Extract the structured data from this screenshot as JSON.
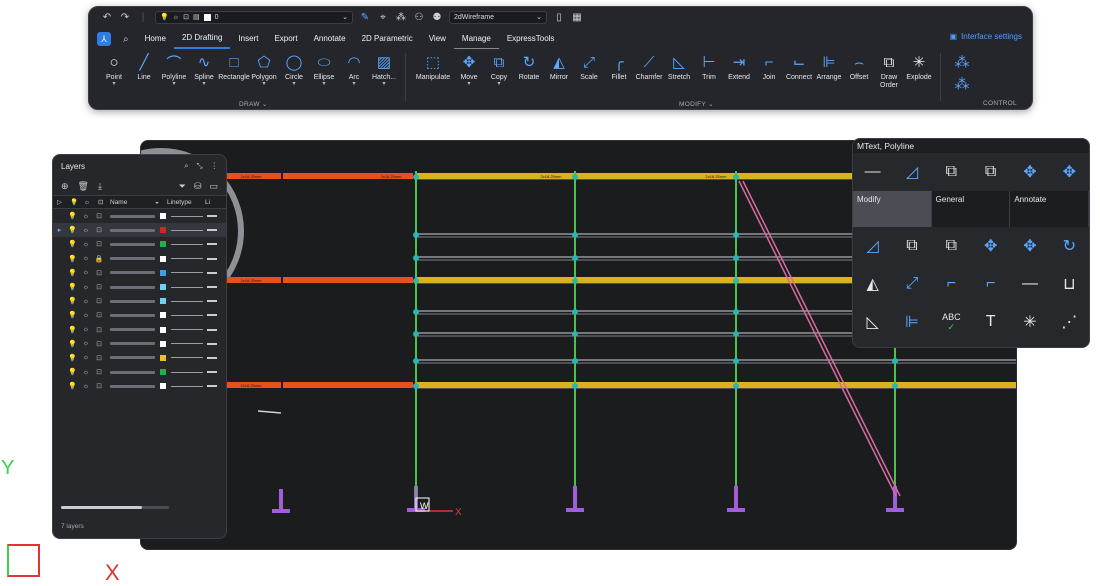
{
  "ribbon": {
    "quick_access": {
      "layer_value": "0",
      "visual_style": "2dWireframe"
    },
    "tabs": [
      "Home",
      "2D Drafting",
      "Insert",
      "Export",
      "Annotate",
      "2D Parametric",
      "View",
      "Manage",
      "ExpressTools"
    ],
    "active_tab": "2D Drafting",
    "interface_settings": "Interface settings",
    "draw_tools": [
      {
        "label": "Point",
        "icon": "point-icon"
      },
      {
        "label": "Line",
        "icon": "line-icon"
      },
      {
        "label": "Polyline",
        "icon": "polyline-icon"
      },
      {
        "label": "Spline",
        "icon": "spline-icon"
      },
      {
        "label": "Rectangle",
        "icon": "rectangle-icon"
      },
      {
        "label": "Polygon",
        "icon": "polygon-icon"
      },
      {
        "label": "Circle",
        "icon": "circle-icon"
      },
      {
        "label": "Ellipse",
        "icon": "ellipse-icon"
      },
      {
        "label": "Arc",
        "icon": "arc-icon"
      },
      {
        "label": "Hatch...",
        "icon": "hatch-icon"
      }
    ],
    "modify_tools": [
      {
        "label": "Manipulate",
        "icon": "manipulate-icon"
      },
      {
        "label": "Move",
        "icon": "move-icon"
      },
      {
        "label": "Copy",
        "icon": "copy-icon"
      },
      {
        "label": "Rotate",
        "icon": "rotate-icon"
      },
      {
        "label": "Mirror",
        "icon": "mirror-icon"
      },
      {
        "label": "Scale",
        "icon": "scale-icon"
      },
      {
        "label": "Fillet",
        "icon": "fillet-icon"
      },
      {
        "label": "Chamfer",
        "icon": "chamfer-icon"
      },
      {
        "label": "Stretch",
        "icon": "stretch-icon"
      },
      {
        "label": "Trim",
        "icon": "trim-icon"
      },
      {
        "label": "Extend",
        "icon": "extend-icon"
      },
      {
        "label": "Join",
        "icon": "join-icon"
      },
      {
        "label": "Connect",
        "icon": "connect-icon"
      },
      {
        "label": "Arrange",
        "icon": "arrange-icon"
      },
      {
        "label": "Offset",
        "icon": "offset-icon"
      },
      {
        "label": "Draw Order",
        "icon": "draw-order-icon"
      },
      {
        "label": "Explode",
        "icon": "explode-icon"
      }
    ],
    "groups": {
      "draw": "DRAW",
      "modify": "MODIFY",
      "control": "CONTROL"
    }
  },
  "layers_panel": {
    "title": "Layers",
    "columns": [
      "Name",
      "Linetype",
      "Li"
    ],
    "rows": [
      {
        "color": "#ffffff",
        "selected": false,
        "locked": false,
        "frozen": false
      },
      {
        "color": "#e02020",
        "selected": true,
        "locked": false,
        "frozen": false
      },
      {
        "color": "#20b24a",
        "selected": false,
        "locked": false,
        "frozen": false
      },
      {
        "color": "#ffffff",
        "selected": false,
        "locked": true,
        "frozen": false
      },
      {
        "color": "#3aa0e8",
        "selected": false,
        "locked": false,
        "frozen": false
      },
      {
        "color": "#6fd0f0",
        "selected": false,
        "locked": false,
        "frozen": false
      },
      {
        "color": "#6fd0f0",
        "selected": false,
        "locked": false,
        "frozen": false
      },
      {
        "color": "#ffffff",
        "selected": false,
        "locked": false,
        "frozen": false
      },
      {
        "color": "#ffffff",
        "selected": false,
        "locked": false,
        "frozen": false
      },
      {
        "color": "#ffffff",
        "selected": false,
        "locked": false,
        "frozen": false
      },
      {
        "color": "#f0c020",
        "selected": false,
        "locked": false,
        "frozen": false
      },
      {
        "color": "#20b24a",
        "selected": false,
        "locked": false,
        "frozen": false
      },
      {
        "color": "#ffffff",
        "selected": false,
        "locked": false,
        "frozen": false
      }
    ],
    "scroll_fraction": 0.75,
    "count": "7 layers"
  },
  "quad": {
    "title": "MText, Polyline",
    "tabs": [
      "Modify",
      "General",
      "Annotate"
    ],
    "active_tab": "Modify",
    "top_icons": [
      "line-icon",
      "polyline-edit-icon",
      "copy-icon",
      "copy-flash-icon",
      "move-icon",
      "move-flash-icon"
    ],
    "grid_icons": [
      [
        "polyline-edit-icon",
        "copy-icon",
        "copy-flash-icon",
        "move-icon",
        "move-flash-icon",
        "rotate-icon"
      ],
      [
        "mirror-icon",
        "scale-icon",
        "trim-icon",
        "extend-icon",
        "line-icon",
        "stretch-icon"
      ],
      [
        "stretch-sheet-icon",
        "arrange-icon",
        "spell-check-icon",
        "text-edit-icon",
        "explode-icon",
        "array-icon"
      ]
    ],
    "abc_label": "ABC"
  },
  "drawing": {
    "tags": [
      "2x18.25mm",
      "2x18.25mm",
      "2x18.25mm",
      "2x18.25mm",
      "2x18.25mm",
      "2x18.25mm"
    ],
    "ucs_x": "X",
    "ucs_y": "Y",
    "ucs_w": "W",
    "colors": {
      "orange": "#e8501c",
      "yellow": "#d9b21e",
      "green": "#4fc04a",
      "cyan": "#2ab5b5",
      "pink": "#d76ba0",
      "purple": "#a15ed8"
    }
  }
}
